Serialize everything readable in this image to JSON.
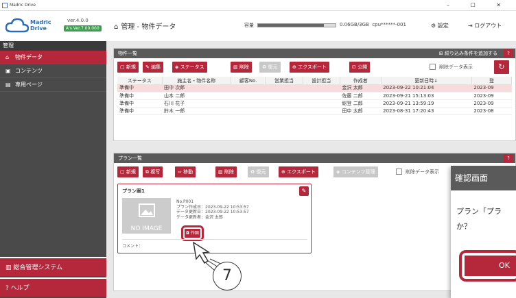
{
  "window": {
    "title": "Madric Drive",
    "buttons": "–  ☐  ✕"
  },
  "logo": {
    "name": "Madric Drive",
    "version": "ver.4.0.0",
    "badge": "A's Ver.7.00.000"
  },
  "breadcrumb": "管理 - 物件データ",
  "storage": {
    "label": "容量",
    "value": "0.06GB/3GB",
    "user": "cpu******-001",
    "fill_pct": 0.02
  },
  "header": {
    "settings": "設定",
    "logout": "ログアウト"
  },
  "sidebar": {
    "head": "管理",
    "items": [
      {
        "label": "物件データ",
        "active": true
      },
      {
        "label": "コンテンツ",
        "active": false
      },
      {
        "label": "専用ページ",
        "active": false
      }
    ],
    "system": "総合管理システム",
    "help": "ヘルプ"
  },
  "property_panel": {
    "title": "物件一覧",
    "filter": "絞り込み条件を追加する",
    "help": "?",
    "toolbar": {
      "new": "新規",
      "edit": "編集",
      "status": "ステータス",
      "delete": "削除",
      "restore": "復元",
      "export": "エクスポート",
      "publish": "公開",
      "show_deleted": "削除データ表示"
    },
    "columns": [
      "ステータス",
      "施主名・物件名称",
      "顧客No.",
      "営業担当",
      "設計担当",
      "作成者",
      "更新日時↓",
      "登"
    ],
    "rows": [
      {
        "status": "準備中",
        "owner": "田中 次郎",
        "no": "",
        "sales": "",
        "design": "",
        "creator": "金沢 太郎",
        "updated": "2023-09-22 10:21:04",
        "reg": "2023-09"
      },
      {
        "status": "準備中",
        "owner": "山本 二郎",
        "no": "",
        "sales": "",
        "design": "",
        "creator": "佐藤 二郎",
        "updated": "2023-09-21 15:13:03",
        "reg": "2023-09"
      },
      {
        "status": "準備中",
        "owner": "石川 花子",
        "no": "",
        "sales": "",
        "design": "",
        "creator": "総登 二郎",
        "updated": "2023-09-21 13:59:19",
        "reg": "2023-09"
      },
      {
        "status": "準備中",
        "owner": "鈴木 一郎",
        "no": "",
        "sales": "",
        "design": "",
        "creator": "田中 太郎",
        "updated": "2023-08-31 17:20:43",
        "reg": "2023-08"
      }
    ]
  },
  "plan_panel": {
    "title": "プラン一覧",
    "help": "?",
    "toolbar": {
      "new": "新規",
      "copy": "複写",
      "move": "移動",
      "delete": "削除",
      "restore": "復元",
      "export": "エクスポート",
      "content": "コンテンツ管理",
      "show_deleted": "削除データ表示"
    },
    "card": {
      "title": "プラン案1",
      "no_image": "NO IMAGE",
      "no": "No.P001",
      "created": "プラン作成日：2023-09-22 10:53:57",
      "updated": "データ更新日：2023-09-22 10:53:57",
      "updater": "データ更新者：金沢 太郎",
      "create": "作図",
      "comment": "コメント："
    }
  },
  "dialog": {
    "title": "確認画面",
    "message_line1": "プラン「プラ",
    "message_line2": "か？",
    "ok": "OK"
  },
  "callout": "7"
}
